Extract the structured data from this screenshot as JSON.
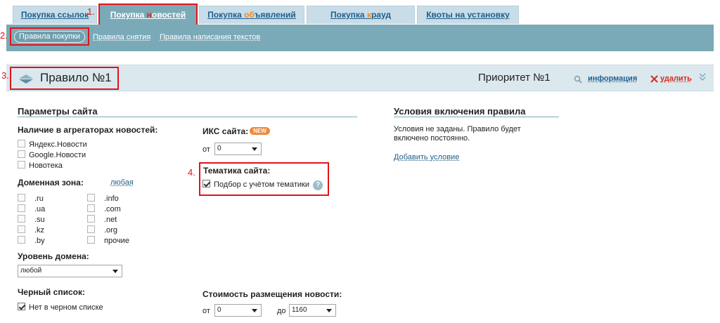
{
  "tabs": [
    {
      "pre": "Покупка ",
      "post": "ссылок",
      "accent": ""
    },
    {
      "pre": "Покупка ",
      "accent": "н",
      "post": "овостей"
    },
    {
      "pre": "Покупка ",
      "accent": "об",
      "post": "ъявлений"
    },
    {
      "pre": "Покупка ",
      "accent": "к",
      "post": "рауд"
    },
    {
      "pre": "Квоты на установку",
      "accent": "",
      "post": ""
    }
  ],
  "markers": {
    "m1": "1.",
    "m2": "2.",
    "m3": "3.",
    "m4": "4."
  },
  "subtabs": {
    "active": "Правила покупки",
    "removal": "Правила снятия",
    "writing": "Правила написания текстов"
  },
  "rule": {
    "title": "Правило №1",
    "priority": "Приоритет №1",
    "info": "информация",
    "delete": "удалить"
  },
  "site": {
    "heading": "Параметры сайта",
    "aggregators_label": "Наличие в агрегаторах новостей:",
    "aggregators": [
      "Яндекс.Новости",
      "Google.Новости",
      "Новотека"
    ],
    "zone_label": "Доменная зона:",
    "zone_any": "любая",
    "zones_left": [
      ".ru",
      ".ua",
      ".su",
      ".kz",
      ".by"
    ],
    "zones_right": [
      ".info",
      ".com",
      ".net",
      ".org",
      "прочие"
    ],
    "level_label": "Уровень домена:",
    "level_value": "любой",
    "blacklist_label": "Черный список:",
    "blacklist_option": "Нет в черном списке",
    "iks_label": "ИКС сайта:",
    "iks_badge": "NEW",
    "from": "от",
    "to": "до",
    "iks_from": "0",
    "topic_label": "Тематика сайта:",
    "topic_option": "Подбор с учётом тематики",
    "price_label": "Стоимость размещения новости:",
    "price_from": "0",
    "price_to": "1160"
  },
  "conditions": {
    "heading": "Условия включения правила",
    "text1": "Условия не заданы. Правило будет",
    "text2": "включено постоянно.",
    "add": "Добавить условие"
  },
  "colors": {
    "accent": "#7aaab8",
    "highlight": "#e0141b",
    "link": "#1f5f8b"
  }
}
